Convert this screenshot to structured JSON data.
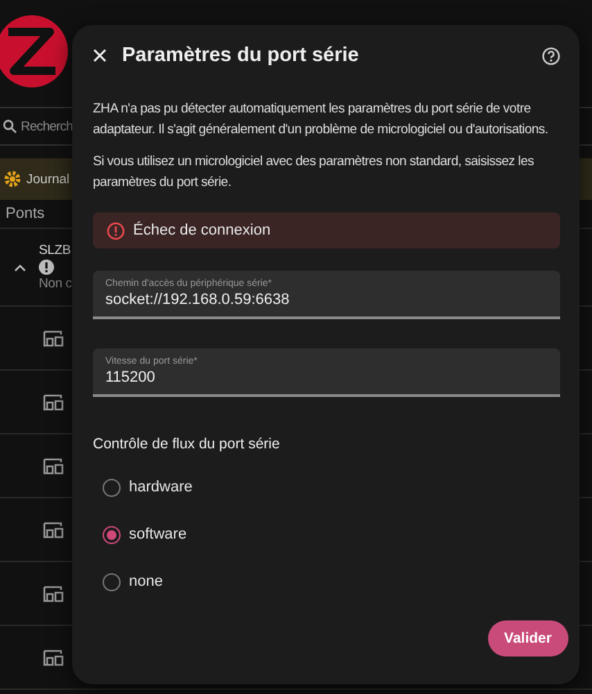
{
  "background": {
    "search": {
      "placeholder": "Recherch"
    },
    "journal": {
      "label": "Journal"
    },
    "section": "Ponts",
    "bridge": {
      "name": "SLZB",
      "status": "Non c",
      "expanded": true
    },
    "devices": [
      {
        "kind": "device"
      },
      {
        "kind": "device"
      },
      {
        "kind": "device"
      },
      {
        "kind": "device"
      },
      {
        "kind": "device"
      },
      {
        "kind": "device"
      }
    ]
  },
  "dialog": {
    "title": "Paramètres du port série",
    "paragraphs": [
      "ZHA n'a pas pu détecter automatiquement les paramètres du port série de votre adaptateur. Il s'agit généralement d'un problème de micrologiciel ou d'autorisations.",
      "Si vous utilisez un micrologiciel avec des paramètres non standard, saisissez les paramètres du port série."
    ],
    "error": {
      "text": "Échec de connexion"
    },
    "fields": [
      {
        "label": "Chemin d'accès du périphérique série*",
        "value": "socket://192.168.0.59:6638"
      },
      {
        "label": "Vitesse du port série*",
        "value": "115200"
      }
    ],
    "flow_control": {
      "title": "Contrôle de flux du port série",
      "options": [
        {
          "label": "hardware",
          "selected": false
        },
        {
          "label": "software",
          "selected": true
        },
        {
          "label": "none",
          "selected": false
        }
      ]
    },
    "submit": "Valider"
  }
}
